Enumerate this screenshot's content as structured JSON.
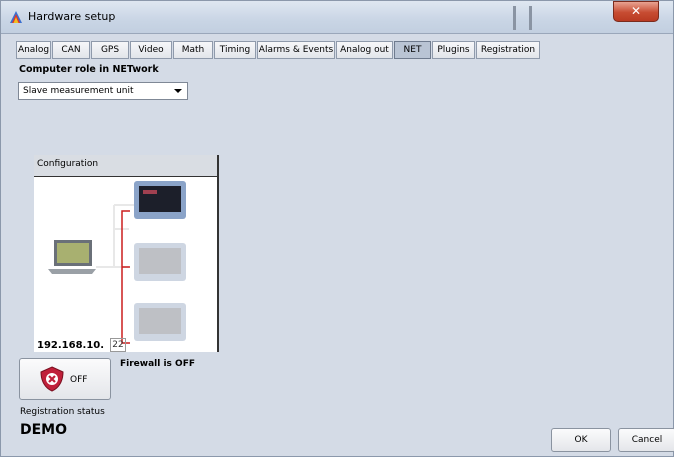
{
  "window": {
    "title": "Hardware setup",
    "close_icon": "close-icon"
  },
  "tabs": [
    {
      "label": "Analog",
      "active": false
    },
    {
      "label": "CAN",
      "active": false
    },
    {
      "label": "GPS",
      "active": false
    },
    {
      "label": "Video",
      "active": false
    },
    {
      "label": "Math",
      "active": false
    },
    {
      "label": "Timing",
      "active": false
    },
    {
      "label": "Alarms & Events",
      "active": false
    },
    {
      "label": "Analog out",
      "active": false
    },
    {
      "label": "NET",
      "active": true
    },
    {
      "label": "Plugins",
      "active": false
    },
    {
      "label": "Registration",
      "active": false
    }
  ],
  "net": {
    "role_label": "Computer role in NETwork",
    "role_value": "Slave measurement unit",
    "config_title": "Configuration",
    "ip_prefix": "192.168.10.",
    "ip_last": "22"
  },
  "firewall": {
    "button_label": "OFF",
    "status_text": "Firewall is OFF",
    "icon": "shield-x-icon"
  },
  "registration": {
    "label": "Registration status",
    "status": "DEMO"
  },
  "buttons": {
    "ok": "OK",
    "cancel": "Cancel"
  },
  "colors": {
    "window_bg": "#d4dbe6",
    "active_tab": "#b9c4d4",
    "network_link": "#cc1f1f",
    "shield": "#c0203a"
  }
}
